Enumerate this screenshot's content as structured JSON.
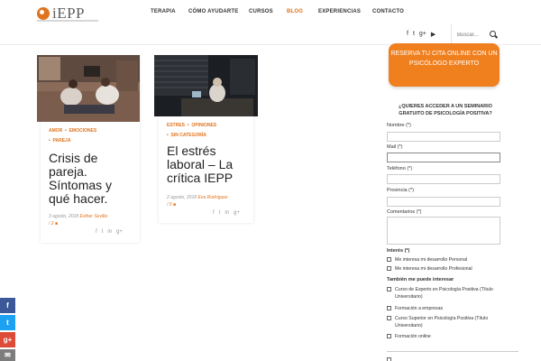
{
  "brand": {
    "name": "iEPP"
  },
  "nav": {
    "items": [
      {
        "label": "TERAPIA"
      },
      {
        "label": "CÓMO AYUDARTE"
      },
      {
        "label": "CURSOS"
      },
      {
        "label": "BLOG"
      },
      {
        "label": "EXPERIENCIAS"
      },
      {
        "label": "CONTACTO"
      }
    ],
    "active": "BLOG"
  },
  "header": {
    "social": [
      {
        "glyph": "f"
      },
      {
        "glyph": "t"
      },
      {
        "glyph": "g+"
      },
      {
        "glyph": "▶"
      }
    ],
    "search_placeholder": "Buscar..."
  },
  "posts": [
    {
      "tags": [
        "AMOR",
        "EMOCIONES",
        "PAREJA"
      ],
      "title": "Crisis de pareja. Síntomas y qué hacer.",
      "date": "3 agosto, 2018",
      "author": "Esther Sevilla",
      "comments": "/ 2"
    },
    {
      "tags": [
        "ESTRES",
        "OPINIONES",
        "SIN CATEGORÍA"
      ],
      "title": "El estrés laboral – La crítica IEPP",
      "date": "2 agosto, 2018",
      "author": "Eva Rodríguez",
      "comments": "/ 0"
    }
  ],
  "share_icons": [
    {
      "glyph": "f"
    },
    {
      "glyph": "t"
    },
    {
      "glyph": "in"
    },
    {
      "glyph": "g+"
    }
  ],
  "sidebar": {
    "cta_label": "RESERVA TU CITA ONLINE CON UN PSICÓLOGO EXPERTO",
    "form_title": "¿QUIERES ACCEDER A UN SEMINARIO GRATUITO DE PSICOLOGÍA POSITIVA?",
    "fields": [
      {
        "label": "Nombre (*)"
      },
      {
        "label": "Mail (*)"
      },
      {
        "label": "Teléfono (*)"
      },
      {
        "label": "Provincia (*)"
      },
      {
        "label": "Comentarios (*)"
      }
    ],
    "interest_label": "Interés (*)",
    "interest_options": [
      {
        "label": "Me interesa mi desarrollo Personal"
      },
      {
        "label": "Me interesa mi desarrollo Profesional"
      }
    ],
    "maybe_label": "También me puede interesar",
    "maybe_options": [
      {
        "label": "Curso de Experto en Psicología Positiva (Título Universitario)"
      },
      {
        "label": "Formación a empresas"
      },
      {
        "label": "Curso Superior en Psicología Positiva (Título Universitario)"
      },
      {
        "label": "Formación online"
      }
    ]
  },
  "float_social": [
    {
      "glyph": "f",
      "color": "#3b5998"
    },
    {
      "glyph": "t",
      "color": "#1da1f2"
    },
    {
      "glyph": "g+",
      "color": "#dd4b39"
    },
    {
      "glyph": "✉",
      "color": "#7d7d7d"
    }
  ],
  "colors": {
    "accent": "#e0741e",
    "cta": "#f07f1e"
  }
}
